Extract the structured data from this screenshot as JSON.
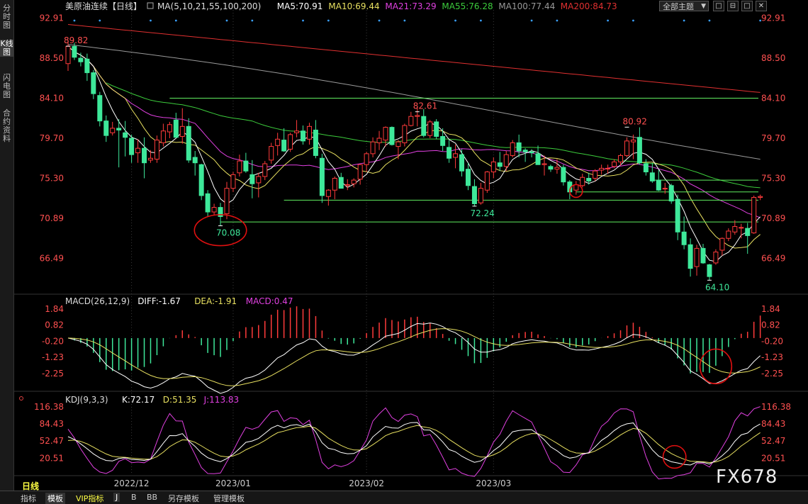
{
  "left_toolbar": [
    {
      "label": "分时图",
      "active": false
    },
    {
      "label": "K线图",
      "active": true
    },
    {
      "label": "闪电图",
      "active": false
    },
    {
      "label": "合约资料",
      "active": false
    }
  ],
  "top_controls": {
    "theme": "全部主题",
    "theme_arrow": "▼",
    "buttons": [
      "□",
      "⊟",
      "□",
      "✕"
    ]
  },
  "period_label": "日线",
  "watermark": "FX678",
  "bottom_tabs": [
    {
      "label": "指标",
      "active": false
    },
    {
      "label": "模板",
      "active": true
    },
    {
      "label": "VIP指标",
      "vip": true
    },
    {
      "label": "J",
      "active": true
    },
    {
      "label": "B"
    },
    {
      "label": "BB"
    },
    {
      "label": "另存模板"
    },
    {
      "label": "管理模板"
    }
  ],
  "colors": {
    "up": "#ff3b3b",
    "down": "#3ee89a",
    "ma5": "#ffffff",
    "ma10": "#e8e060",
    "ma21": "#e040e0",
    "ma55": "#3ccc3c",
    "ma100": "#999999",
    "ma200": "#e03030",
    "hline": "#60ee60",
    "circle": "#e01010",
    "diff": "#ffffff",
    "dea": "#e8e060",
    "kdj_k": "#ffffff",
    "kdj_d": "#e8e060",
    "kdj_j": "#e040e0",
    "axis_label": "#ff5050"
  },
  "chart_data": [
    {
      "type": "candlestick",
      "title": "美原油连续【日线】",
      "legend": [
        {
          "name": "MA(5,10,21,55,100,200)",
          "color": "#dddddd"
        },
        {
          "name": "MA5:70.91",
          "color": "#ffffff"
        },
        {
          "name": "MA10:69.44",
          "color": "#e8e060"
        },
        {
          "name": "MA21:73.29",
          "color": "#e040e0"
        },
        {
          "name": "MA55:76.28",
          "color": "#3ccc3c"
        },
        {
          "name": "MA100:77.44",
          "color": "#999999"
        },
        {
          "name": "MA200:84.73",
          "color": "#e03030"
        }
      ],
      "y_ticks": [
        92.91,
        88.5,
        84.1,
        79.7,
        75.3,
        70.89,
        66.49
      ],
      "y_tick_labels": [
        "92.91",
        "88.50",
        "84.10",
        "79.70",
        "75.30",
        "70.89",
        "66.49"
      ],
      "ylim": [
        62.8,
        93.8
      ],
      "x_labels": [
        {
          "text": "2022/12",
          "index": 10
        },
        {
          "text": "2023/01",
          "index": 26
        },
        {
          "text": "2023/02",
          "index": 47
        },
        {
          "text": "2023/03",
          "index": 67
        }
      ],
      "ohlc": [
        [
          87.9,
          90.4,
          87.1,
          89.8
        ],
        [
          89.8,
          90.2,
          88.3,
          88.6
        ],
        [
          88.5,
          89.1,
          87.6,
          88.1
        ],
        [
          88.4,
          89.0,
          86.0,
          86.9
        ],
        [
          86.9,
          87.2,
          84.0,
          84.6
        ],
        [
          84.4,
          84.8,
          81.0,
          81.6
        ],
        [
          81.6,
          82.2,
          79.3,
          80.0
        ],
        [
          80.3,
          81.5,
          80.0,
          80.8
        ],
        [
          80.8,
          81.8,
          76.5,
          80.6
        ],
        [
          80.3,
          81.6,
          77.7,
          79.8
        ],
        [
          79.7,
          80.1,
          77.0,
          77.9
        ],
        [
          78.1,
          79.6,
          77.0,
          78.6
        ],
        [
          78.6,
          79.8,
          75.3,
          77.0
        ],
        [
          77.3,
          78.4,
          77.0,
          77.5
        ],
        [
          77.4,
          80.0,
          77.0,
          79.5
        ],
        [
          79.2,
          81.3,
          78.8,
          80.5
        ],
        [
          80.4,
          81.5,
          79.7,
          81.2
        ],
        [
          81.7,
          82.5,
          79.9,
          79.8
        ],
        [
          79.9,
          83.0,
          79.1,
          81.0
        ],
        [
          81.0,
          81.9,
          77.0,
          77.3
        ],
        [
          77.6,
          78.3,
          75.6,
          77.0
        ],
        [
          76.8,
          76.9,
          72.9,
          73.4
        ],
        [
          73.6,
          74.0,
          71.1,
          71.6
        ],
        [
          71.6,
          72.5,
          71.2,
          72.1
        ],
        [
          72.1,
          72.6,
          70.1,
          71.1
        ],
        [
          71.4,
          74.9,
          70.8,
          74.2
        ],
        [
          74.2,
          76.0,
          73.8,
          75.7
        ],
        [
          75.9,
          77.9,
          75.5,
          77.2
        ],
        [
          77.2,
          78.1,
          75.9,
          76.1
        ],
        [
          75.7,
          77.3,
          73.1,
          74.7
        ],
        [
          74.8,
          75.9,
          73.2,
          75.5
        ],
        [
          75.5,
          77.2,
          75.1,
          76.9
        ],
        [
          77.3,
          79.2,
          76.9,
          78.8
        ],
        [
          78.9,
          80.3,
          77.8,
          79.6
        ],
        [
          79.5,
          80.8,
          78.2,
          78.3
        ],
        [
          78.5,
          80.3,
          78.2,
          80.1
        ],
        [
          80.3,
          81.7,
          79.8,
          80.5
        ],
        [
          80.5,
          81.1,
          79.0,
          79.4
        ],
        [
          79.6,
          81.4,
          79.0,
          81.0
        ],
        [
          80.6,
          81.7,
          77.5,
          77.8
        ],
        [
          77.5,
          78.0,
          72.6,
          73.4
        ],
        [
          73.3,
          74.1,
          72.3,
          74.0
        ],
        [
          74.0,
          75.5,
          73.0,
          75.3
        ],
        [
          75.4,
          75.9,
          74.9,
          74.2
        ],
        [
          74.5,
          75.2,
          74.0,
          74.6
        ],
        [
          74.7,
          75.3,
          74.3,
          75.1
        ],
        [
          75.2,
          76.9,
          74.6,
          76.8
        ],
        [
          76.8,
          78.2,
          76.0,
          78.0
        ],
        [
          78.0,
          79.8,
          77.6,
          79.3
        ],
        [
          79.2,
          80.5,
          78.4,
          79.7
        ],
        [
          79.5,
          81.0,
          78.8,
          80.9
        ],
        [
          80.9,
          81.0,
          78.9,
          79.0
        ],
        [
          78.8,
          79.5,
          77.4,
          79.3
        ],
        [
          79.2,
          81.3,
          78.8,
          81.1
        ],
        [
          81.1,
          82.6,
          81.0,
          82.1
        ],
        [
          82.1,
          83.1,
          81.0,
          82.2
        ],
        [
          82.1,
          82.9,
          79.8,
          80.0
        ],
        [
          80.0,
          81.7,
          79.7,
          81.5
        ],
        [
          81.5,
          81.8,
          79.6,
          79.9
        ],
        [
          79.9,
          80.8,
          78.3,
          78.9
        ],
        [
          78.7,
          79.5,
          77.0,
          77.5
        ],
        [
          77.6,
          79.0,
          76.4,
          78.0
        ],
        [
          77.9,
          78.5,
          75.5,
          76.1
        ],
        [
          76.3,
          77.0,
          74.0,
          74.5
        ],
        [
          74.4,
          75.2,
          72.2,
          72.5
        ],
        [
          72.6,
          74.8,
          72.4,
          74.2
        ],
        [
          74.0,
          76.1,
          73.7,
          76.0
        ],
        [
          76.0,
          77.6,
          75.3,
          77.1
        ],
        [
          77.0,
          78.2,
          76.1,
          76.6
        ],
        [
          76.6,
          78.3,
          76.1,
          77.9
        ],
        [
          77.8,
          79.5,
          77.6,
          79.2
        ],
        [
          79.2,
          80.1,
          77.6,
          78.3
        ],
        [
          78.4,
          78.6,
          77.1,
          78.2
        ],
        [
          78.2,
          78.5,
          77.6,
          78.1
        ],
        [
          78.0,
          78.9,
          76.8,
          76.8
        ],
        [
          76.8,
          77.8,
          75.6,
          76.9
        ],
        [
          76.6,
          76.8,
          76.0,
          76.3
        ],
        [
          76.3,
          77.4,
          75.8,
          76.5
        ],
        [
          76.5,
          76.8,
          74.5,
          74.9
        ],
        [
          74.9,
          75.1,
          73.0,
          73.8
        ],
        [
          74.0,
          75.0,
          73.5,
          74.6
        ],
        [
          74.5,
          75.8,
          74.3,
          75.4
        ],
        [
          75.3,
          75.9,
          74.6,
          75.0
        ],
        [
          75.3,
          76.3,
          75.0,
          76.1
        ],
        [
          76.2,
          76.8,
          75.7,
          76.4
        ],
        [
          76.4,
          76.8,
          75.8,
          76.4
        ],
        [
          76.6,
          77.4,
          76.4,
          77.1
        ],
        [
          77.1,
          78.0,
          76.7,
          77.8
        ],
        [
          77.8,
          79.8,
          77.6,
          79.4
        ],
        [
          79.3,
          80.1,
          77.4,
          79.5
        ],
        [
          79.8,
          80.9,
          76.8,
          77.0
        ],
        [
          76.9,
          77.4,
          75.6,
          76.0
        ],
        [
          75.9,
          77.0,
          74.8,
          75.0
        ],
        [
          75.1,
          76.2,
          73.9,
          74.0
        ],
        [
          74.2,
          74.8,
          73.6,
          74.2
        ],
        [
          74.5,
          74.7,
          72.5,
          72.8
        ],
        [
          73.0,
          73.5,
          68.5,
          69.4
        ],
        [
          69.4,
          71.1,
          67.5,
          68.0
        ],
        [
          68.0,
          68.7,
          64.5,
          65.4
        ],
        [
          65.6,
          68.0,
          64.6,
          67.6
        ],
        [
          67.6,
          68.1,
          65.9,
          66.0
        ],
        [
          65.8,
          65.9,
          64.1,
          64.5
        ],
        [
          66.0,
          67.5,
          65.8,
          67.2
        ],
        [
          67.4,
          68.8,
          66.8,
          68.7
        ],
        [
          68.7,
          69.8,
          68.4,
          69.5
        ],
        [
          69.4,
          70.7,
          69.1,
          70.0
        ],
        [
          69.9,
          70.3,
          68.7,
          69.9
        ],
        [
          69.8,
          70.4,
          67.0,
          69.0
        ],
        [
          69.3,
          73.4,
          69.2,
          73.2
        ],
        [
          73.2,
          73.5,
          72.9,
          73.3
        ]
      ],
      "price_labels": [
        {
          "text": "89.82",
          "index": 0,
          "value": 89.82,
          "color": "#ff5050"
        },
        {
          "text": "82.61",
          "index": 55,
          "value": 82.61,
          "color": "#ff5050"
        },
        {
          "text": "80.92",
          "index": 88,
          "value": 80.92,
          "color": "#ff5050"
        },
        {
          "text": "70.08",
          "index": 24,
          "value": 70.08,
          "color": "#3ee89a"
        },
        {
          "text": "72.24",
          "index": 64,
          "value": 72.24,
          "color": "#3ee89a"
        },
        {
          "text": "64.10",
          "index": 101,
          "value": 64.1,
          "color": "#3ee89a"
        }
      ],
      "hlines": [
        {
          "y": 84.1,
          "from": 16
        },
        {
          "y": 75.1,
          "from": 92
        },
        {
          "y": 73.8,
          "from": 80
        },
        {
          "y": 72.9,
          "from": 34
        },
        {
          "y": 70.5,
          "from": 24
        }
      ],
      "circles": [
        {
          "cx": 24,
          "cy": 69.6,
          "rx": 4.1,
          "ry": 1.7
        },
        {
          "cx": 80,
          "cy": 73.9,
          "rx": 1,
          "ry": 0.7
        }
      ]
    },
    {
      "type": "macd",
      "title": "MACD(26,12,9)",
      "legend": [
        {
          "name": "MACD(26,12,9)",
          "color": "#dddddd"
        },
        {
          "name": "DIFF:-1.67",
          "color": "#ffffff"
        },
        {
          "name": "DEA:-1.91",
          "color": "#e8e060"
        },
        {
          "name": "MACD:0.47",
          "color": "#e040e0"
        }
      ],
      "y_ticks": [
        1.84,
        0.82,
        -0.2,
        -1.23,
        -2.25
      ],
      "y_tick_labels": [
        "1.84",
        "0.82",
        "-0.20",
        "-1.23",
        "-2.25"
      ],
      "ylim": [
        -3.2,
        2.2
      ],
      "circles": [
        {
          "cx": 102,
          "cy": -1.8,
          "rx": 2.5,
          "ry": 1.1
        }
      ]
    },
    {
      "type": "kdj",
      "title": "KDJ(9,3,3)",
      "legend": [
        {
          "name": "KDJ(9,3,3)",
          "color": "#dddddd"
        },
        {
          "name": "K:72.17",
          "color": "#ffffff"
        },
        {
          "name": "D:51.35",
          "color": "#e8e060"
        },
        {
          "name": "J:113.83",
          "color": "#e040e0"
        }
      ],
      "y_ticks": [
        116.38,
        84.43,
        52.47,
        20.51
      ],
      "y_tick_labels": [
        "116.38",
        "84.43",
        "52.47",
        "20.51"
      ],
      "ylim": [
        -8,
        128
      ],
      "circles": [
        {
          "cx": 95.5,
          "cy": 23,
          "rx": 1.8,
          "ry": 21
        }
      ]
    }
  ]
}
